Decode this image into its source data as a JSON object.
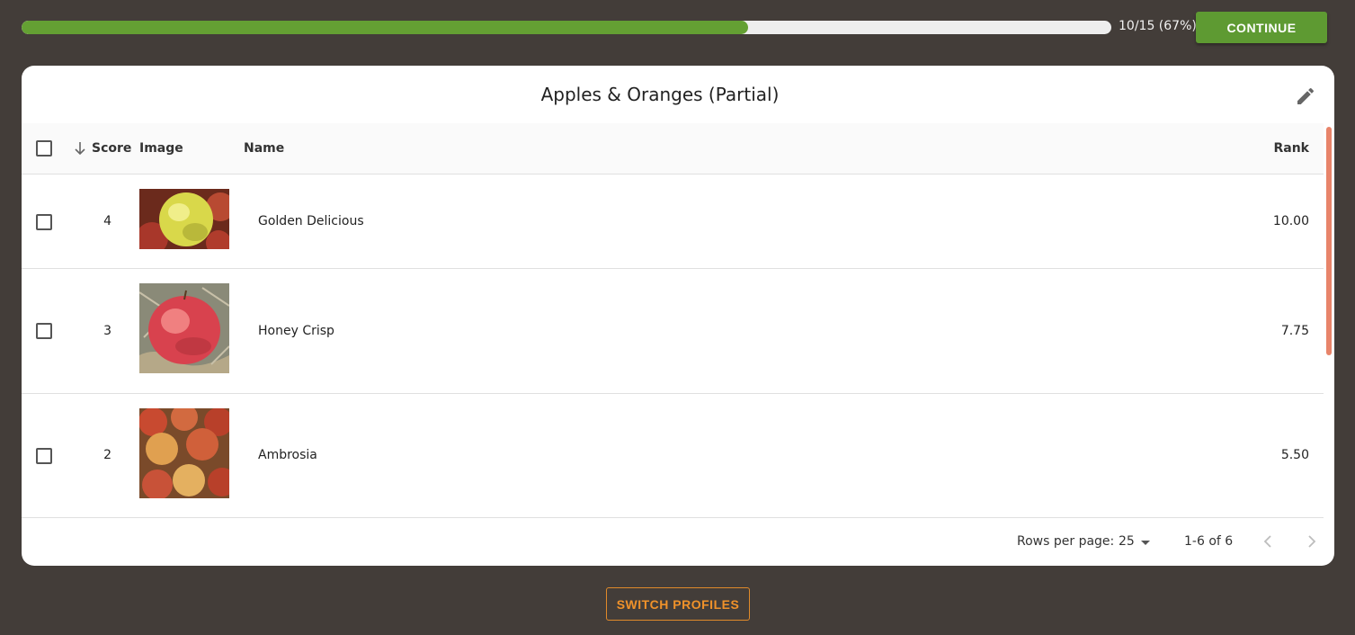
{
  "progress": {
    "text": "10/15 (67%)",
    "fraction": 0.6667,
    "fill_color": "#64a033"
  },
  "toolbar": {
    "continue_label": "CONTINUE"
  },
  "card": {
    "title": "Apples & Oranges (Partial)",
    "edit_icon": "pencil-icon"
  },
  "table": {
    "columns": {
      "score": "Score",
      "image": "Image",
      "name": "Name",
      "rank": "Rank"
    },
    "rows": [
      {
        "score": "4",
        "name": "Golden Delicious",
        "rank": "10.00",
        "image_desc": "yellow-apple"
      },
      {
        "score": "3",
        "name": "Honey Crisp",
        "rank": "7.75",
        "image_desc": "red-apple"
      },
      {
        "score": "2",
        "name": "Ambrosia",
        "rank": "5.50",
        "image_desc": "apple-pile"
      }
    ]
  },
  "pagination": {
    "rows_per_page_label": "Rows per page:",
    "rows_per_page_value": "25",
    "range": "1-6 of 6"
  },
  "switch_label": "SWITCH PROFILES",
  "colors": {
    "background": "#433d39",
    "accent_green": "#5e9a32",
    "accent_orange": "#f0922a"
  }
}
